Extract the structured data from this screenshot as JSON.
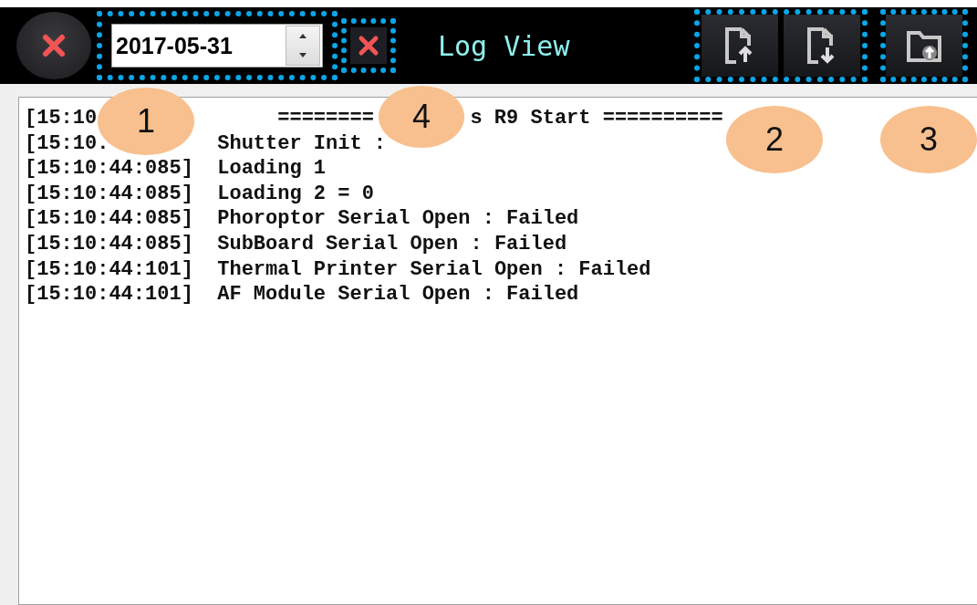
{
  "toolbar": {
    "date": "2017-05-31",
    "title": "Log View"
  },
  "log_lines": [
    {
      "time": "[15:10",
      "message": [
        "========",
        "s R9 Start =========="
      ]
    },
    {
      "time": "[15:10.",
      "message": [
        "Shutter Init :"
      ]
    },
    {
      "time": "[15:10:44:085]",
      "message": [
        "Loading 1"
      ]
    },
    {
      "time": "[15:10:44:085]",
      "message": [
        "Loading 2 = 0"
      ]
    },
    {
      "time": "[15:10:44:085]",
      "message": [
        "Phoroptor Serial Open : Failed"
      ]
    },
    {
      "time": "[15:10:44:085]",
      "message": [
        "SubBoard Serial Open : Failed"
      ]
    },
    {
      "time": "[15:10:44:101]",
      "message": [
        "Thermal Printer Serial Open : Failed"
      ]
    },
    {
      "time": "[15:10:44:101]",
      "message": [
        "AF Module Serial Open : Failed"
      ]
    }
  ],
  "callouts": [
    "1",
    "4",
    "2",
    "3"
  ]
}
